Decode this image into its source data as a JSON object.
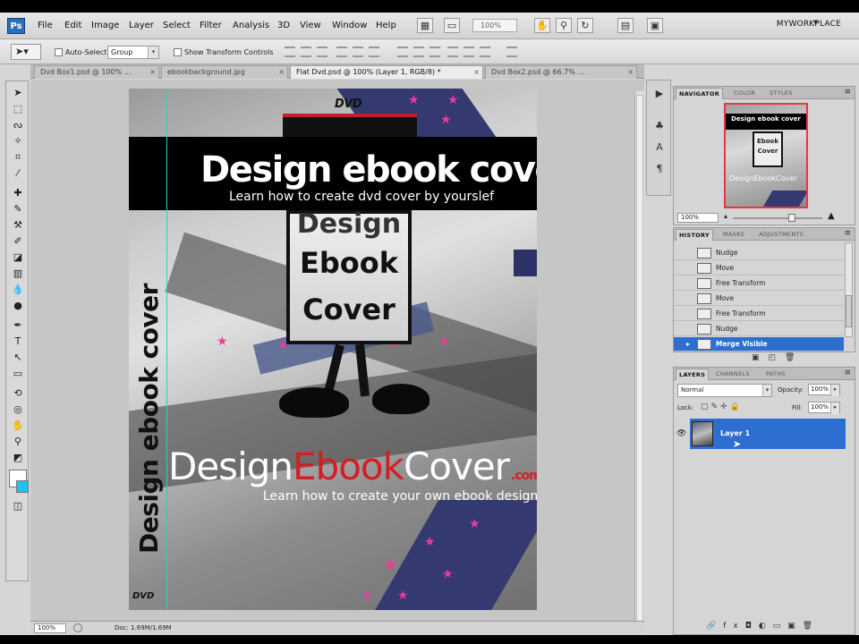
{
  "app": {
    "logo": "Ps",
    "workspace": "MYWORKPLACE"
  },
  "menu": [
    "File",
    "Edit",
    "Image",
    "Layer",
    "Select",
    "Filter",
    "Analysis",
    "3D",
    "View",
    "Window",
    "Help"
  ],
  "menubar": {
    "zoom_value": "100%"
  },
  "options": {
    "auto_select_label": "Auto-Select:",
    "auto_select_value": "Group",
    "show_transform_label": "Show Transform Controls"
  },
  "tabs": [
    {
      "label": "Dvd Box1.psd @ 100% ..."
    },
    {
      "label": "ebookbackground.jpg"
    },
    {
      "label": "Flat Dvd.psd @ 100% (Layer 1, RGB/8) *",
      "active": true
    },
    {
      "label": "Dvd Box2.psd @ 66.7% ..."
    }
  ],
  "artwork": {
    "dvd_logo": "DVD",
    "title": "Design ebook cover",
    "subtitle": "Learn how to create dvd cover by yourslef",
    "sign_lines": [
      "Design",
      "Ebook",
      "Cover"
    ],
    "brand_part1": "Design",
    "brand_part2": "Ebook",
    "brand_part3": "Cover",
    "brand_com": ".com",
    "brand_sub": "Learn how to create your own ebook design",
    "spine_text": "Design ebook cover",
    "spine_dvd": "DVD"
  },
  "status": {
    "zoom": "100%",
    "doc": "Doc: 1.69M/1.69M"
  },
  "panels": {
    "navigator_tabs": [
      "NAVIGATOR",
      "COLOR",
      "STYLES"
    ],
    "navigator_thumb": {
      "title": "Design ebook cover",
      "sign": "Ebook Cover",
      "brand": "DesignEbookCover"
    },
    "navigator_zoom": "100%",
    "history_tabs": [
      "HISTORY",
      "MASKS",
      "ADJUSTMENTS"
    ],
    "history_items": [
      {
        "label": "Nudge"
      },
      {
        "label": "Move"
      },
      {
        "label": "Free Transform"
      },
      {
        "label": "Move"
      },
      {
        "label": "Free Transform"
      },
      {
        "label": "Nudge"
      },
      {
        "label": "Merge Visible",
        "selected": true
      }
    ],
    "layers_tabs": [
      "LAYERS",
      "CHANNELS",
      "PATHS"
    ],
    "blend_mode": "Normal",
    "opacity_label": "Opacity:",
    "opacity_value": "100%",
    "lock_label": "Lock:",
    "fill_label": "Fill:",
    "fill_value": "100%",
    "layer_name": "Layer 1"
  },
  "colors": {
    "selection_blue": "#2d6fd1",
    "stripe_navy": "#34396f",
    "star_pink": "#ee3a9a",
    "brand_red": "#d21f26"
  }
}
